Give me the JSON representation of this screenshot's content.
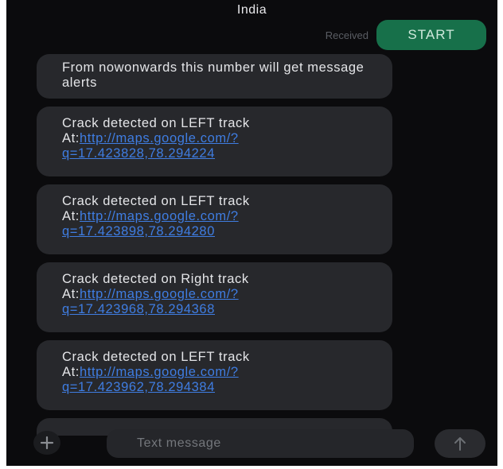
{
  "header": {
    "title": "India"
  },
  "status": {
    "received_label": "Received",
    "start_label": "START"
  },
  "messages": [
    {
      "text": "From nowonwards this number will get message alerts"
    },
    {
      "line1": "Crack detected on LEFT track",
      "prefix": "At:",
      "link_a": "http://maps.google.com/?",
      "link_b": "q=17.423828,78.294224"
    },
    {
      "line1": "Crack detected on LEFT track",
      "prefix": "At:",
      "link_a": "http://maps.google.com/?",
      "link_b": "q=17.423898,78.294280"
    },
    {
      "line1": "Crack detected on Right track",
      "prefix": "At:",
      "link_a": "http://maps.google.com/?",
      "link_b": "q=17.423968,78.294368"
    },
    {
      "line1": "Crack detected on LEFT track",
      "prefix": "At:",
      "link_a": "http://maps.google.com/?",
      "link_b": "q=17.423962,78.294384"
    }
  ],
  "compose": {
    "placeholder": "Text message"
  },
  "icons": {
    "add": "plus-icon",
    "send": "arrow-up-icon"
  },
  "colors": {
    "background": "#0b0b0d",
    "bubble": "#27282c",
    "start_button": "#17704a",
    "link": "#3f7de2"
  }
}
